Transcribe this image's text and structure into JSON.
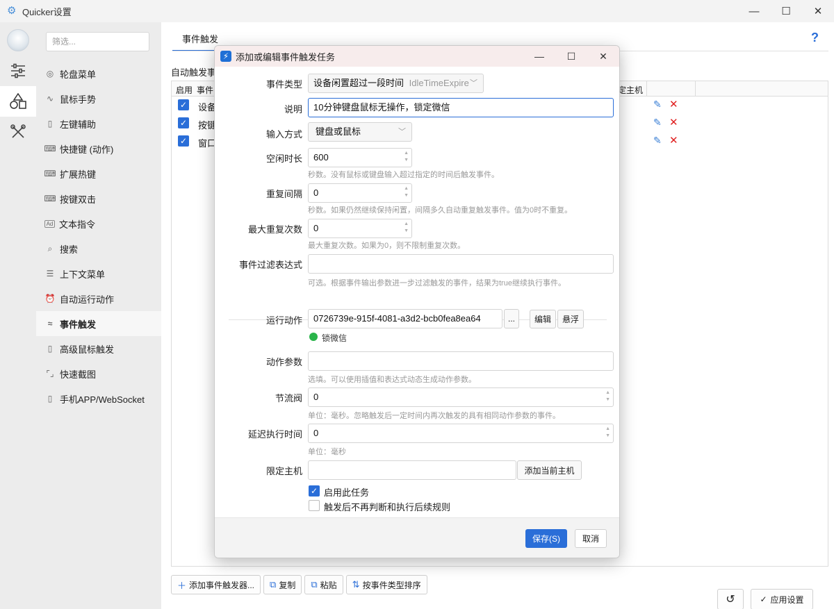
{
  "window": {
    "title": "Quicker设置",
    "minimize": "—",
    "maximize": "☐",
    "close": "✕"
  },
  "sidebar": {
    "filter_placeholder": "筛选...",
    "items": [
      {
        "label": "轮盘菜单",
        "icon": "wheel-icon"
      },
      {
        "label": "鼠标手势",
        "icon": "gesture-icon"
      },
      {
        "label": "左键辅助",
        "icon": "mouse-icon"
      },
      {
        "label": "快捷键 (动作)",
        "icon": "keyboard-icon"
      },
      {
        "label": "扩展热键",
        "icon": "keyboard-icon"
      },
      {
        "label": "按键双击",
        "icon": "keyboard-icon"
      },
      {
        "label": "文本指令",
        "icon": "ad-icon"
      },
      {
        "label": "搜索",
        "icon": "search-icon"
      },
      {
        "label": "上下文菜单",
        "icon": "menu-icon"
      },
      {
        "label": "自动运行动作",
        "icon": "alarm-icon"
      },
      {
        "label": "事件触发",
        "icon": "event-icon"
      },
      {
        "label": "高级鼠标触发",
        "icon": "mouse-icon"
      },
      {
        "label": "快速截图",
        "icon": "crop-icon"
      },
      {
        "label": "手机APP/WebSocket",
        "icon": "phone-icon"
      }
    ]
  },
  "content": {
    "tab": "事件触发",
    "help": "?",
    "section_label": "自动触发事",
    "grid": {
      "headers": [
        "启用",
        "事件",
        "定主机"
      ],
      "rows": [
        {
          "name": "设备"
        },
        {
          "name": "按键"
        },
        {
          "name": "窗口"
        }
      ]
    },
    "toolbar": {
      "add": "添加事件触发器...",
      "copy": "复制",
      "paste": "粘贴",
      "sort": "按事件类型排序",
      "apply": "应用设置"
    }
  },
  "dialog": {
    "title": "添加或编辑事件触发任务",
    "event_type_label": "事件类型",
    "event_type_value": "设备闲置超过一段时间",
    "event_type_code": "IdleTimeExpire",
    "desc_label": "说明",
    "desc_value": "10分钟键盘鼠标无操作，锁定微信",
    "input_mode_label": "输入方式",
    "input_mode_value": "键盘或鼠标",
    "idle_label": "空闲时长",
    "idle_value": "600",
    "idle_hint": "秒数。没有鼠标或键盘输入超过指定的时间后触发事件。",
    "repeat_label": "重复间隔",
    "repeat_value": "0",
    "repeat_hint": "秒数。如果仍然继续保持闲置，间隔多久自动重复触发事件。值为0时不重复。",
    "max_repeat_label": "最大重复次数",
    "max_repeat_value": "0",
    "max_repeat_hint": "最大重复次数。如果为0，则不限制重复次数。",
    "filter_label": "事件过滤表达式",
    "filter_value": "",
    "filter_hint": "可选。根据事件输出参数进一步过滤触发的事件，结果为true继续执行事件。",
    "action_label": "运行动作",
    "action_value": "0726739e-915f-4081-a3d2-bcb0fea8ea64",
    "action_more": "...",
    "action_edit": "编辑",
    "action_float": "悬浮",
    "action_name": "锁微信",
    "params_label": "动作参数",
    "params_value": "",
    "params_hint": "选填。可以使用插值和表达式动态生成动作参数。",
    "throttle_label": "节流阀",
    "throttle_value": "0",
    "throttle_hint": "单位：毫秒。忽略触发后一定时间内再次触发的具有相同动作参数的事件。",
    "delay_label": "延迟执行时间",
    "delay_value": "0",
    "delay_hint": "单位：毫秒",
    "host_label": "限定主机",
    "host_value": "",
    "host_add": "添加当前主机",
    "enable_label": "启用此任务",
    "enable_checked": true,
    "stop_label": "触发后不再判断和执行后续规则",
    "stop_checked": false,
    "save": "保存(S)",
    "cancel": "取消"
  }
}
